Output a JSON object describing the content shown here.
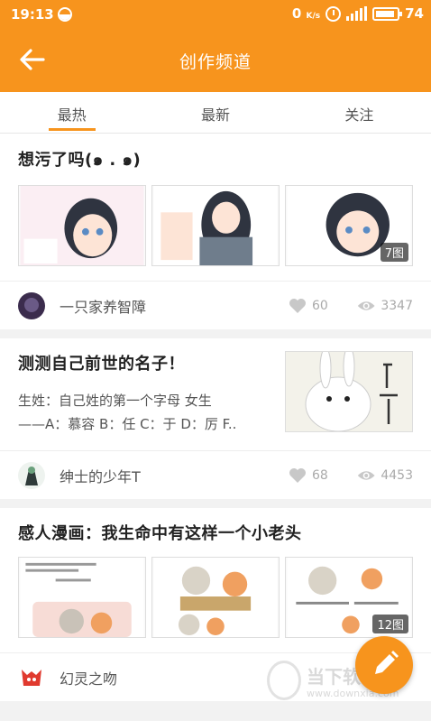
{
  "status_bar": {
    "time": "19:13",
    "net_speed": "0",
    "net_unit": "K/s",
    "battery": "74"
  },
  "header": {
    "title": "创作频道"
  },
  "tabs": [
    {
      "label": "最热"
    },
    {
      "label": "最新"
    },
    {
      "label": "关注"
    }
  ],
  "posts": [
    {
      "title": "想污了吗(๑ . ๑)",
      "image_count": "7图",
      "author": "一只家养智障",
      "likes": "60",
      "views": "3347"
    },
    {
      "title": "测测自己前世的名子！",
      "excerpt_line1": "生姓：自己姓的第一个字母 女生",
      "excerpt_line2": "——A：慕容 B：任 C：于 D：厉 F..",
      "author": "绅士的少年T",
      "likes": "68",
      "views": "4453"
    },
    {
      "title": "感人漫画：我生命中有这样一个小老头",
      "image_count": "12图",
      "author": "幻灵之吻",
      "likes": "",
      "views": ""
    }
  ],
  "watermark": {
    "text": "当下软件园",
    "url": "www.downxia.com"
  },
  "colors": {
    "accent": "#f7941d"
  }
}
